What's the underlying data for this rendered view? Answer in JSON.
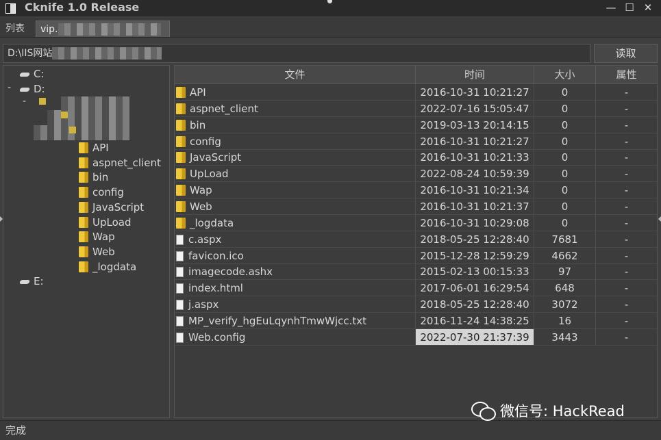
{
  "window": {
    "title": "Cknife 1.0 Release",
    "minimize": "—",
    "maximize": "☐",
    "close": "✕"
  },
  "tabs": {
    "list_label": "列表",
    "active_label": "vip."
  },
  "path_bar": {
    "path": "D:\\IIS网站",
    "read_button": "读取"
  },
  "tree": {
    "drive_c": "C:",
    "drive_d": "D:",
    "drive_e": "E:",
    "expander_minus": "-",
    "folders": [
      "API",
      "aspnet_client",
      "bin",
      "config",
      "JavaScript",
      "UpLoad",
      "Wap",
      "Web",
      "_logdata"
    ]
  },
  "table": {
    "headers": {
      "name": "文件",
      "time": "时间",
      "size": "大小",
      "attr": "属性"
    },
    "rows": [
      {
        "type": "folder",
        "name": "API",
        "time": "2016-10-31 10:21:27",
        "size": "0",
        "attr": "-"
      },
      {
        "type": "folder",
        "name": "aspnet_client",
        "time": "2022-07-16 15:05:47",
        "size": "0",
        "attr": "-"
      },
      {
        "type": "folder",
        "name": "bin",
        "time": "2019-03-13 20:14:15",
        "size": "0",
        "attr": "-"
      },
      {
        "type": "folder",
        "name": "config",
        "time": "2016-10-31 10:21:27",
        "size": "0",
        "attr": "-"
      },
      {
        "type": "folder",
        "name": "JavaScript",
        "time": "2016-10-31 10:21:33",
        "size": "0",
        "attr": "-"
      },
      {
        "type": "folder",
        "name": "UpLoad",
        "time": "2022-08-24 10:59:39",
        "size": "0",
        "attr": "-"
      },
      {
        "type": "folder",
        "name": "Wap",
        "time": "2016-10-31 10:21:34",
        "size": "0",
        "attr": "-"
      },
      {
        "type": "folder",
        "name": "Web",
        "time": "2016-10-31 10:21:37",
        "size": "0",
        "attr": "-"
      },
      {
        "type": "folder",
        "name": "_logdata",
        "time": "2016-10-31 10:29:08",
        "size": "0",
        "attr": "-"
      },
      {
        "type": "file",
        "name": "c.aspx",
        "time": "2018-05-25 12:28:40",
        "size": "7681",
        "attr": "-"
      },
      {
        "type": "file",
        "name": "favicon.ico",
        "time": "2015-12-28 12:59:29",
        "size": "4662",
        "attr": "-"
      },
      {
        "type": "file",
        "name": "imagecode.ashx",
        "time": "2015-02-13 00:15:33",
        "size": "97",
        "attr": "-"
      },
      {
        "type": "file",
        "name": "index.html",
        "time": "2017-06-01 16:29:54",
        "size": "648",
        "attr": "-"
      },
      {
        "type": "file",
        "name": "j.aspx",
        "time": "2018-05-25 12:28:40",
        "size": "3072",
        "attr": "-"
      },
      {
        "type": "file",
        "name": "MP_verify_hgEuLqynhTmwWjcc.txt",
        "time": "2016-11-24 14:38:25",
        "size": "16",
        "attr": "-"
      },
      {
        "type": "file",
        "name": "Web.config",
        "time": "2022-07-30 21:37:39",
        "size": "3443",
        "attr": "-"
      }
    ]
  },
  "status": {
    "text": "完成"
  },
  "watermark": {
    "text": "微信号: HackRead"
  }
}
